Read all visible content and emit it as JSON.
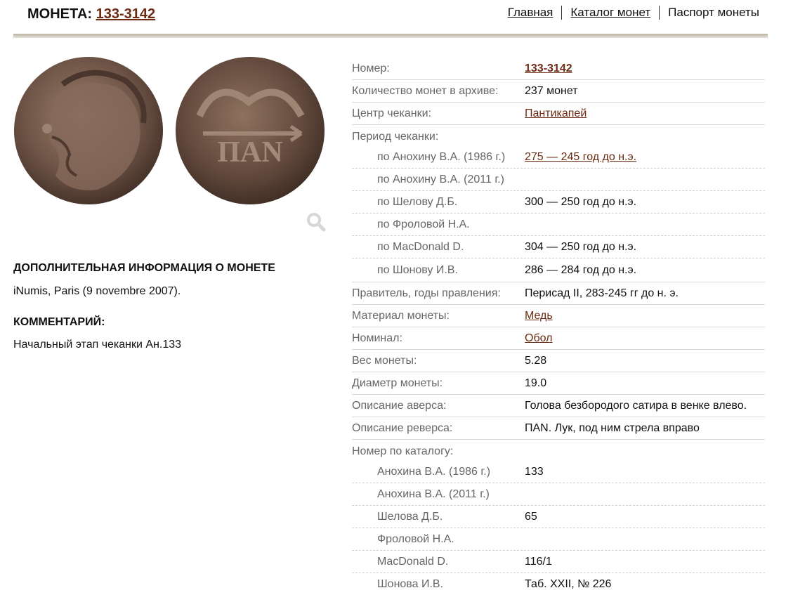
{
  "header": {
    "title_prefix": "МОНЕТА:",
    "coin_id": "133-3142",
    "nav": [
      "Главная",
      "Каталог монет",
      "Паспорт монеты"
    ]
  },
  "images": {
    "obverse_icon": "coin-obverse-image",
    "reverse_icon": "coin-reverse-image",
    "reverse_legend": "ΠΑΝ",
    "zoom_icon": "magnifier-icon"
  },
  "left": {
    "extra_title": "ДОПОЛНИТЕЛЬНАЯ ИНФОРМАЦИЯ О МОНЕТЕ",
    "extra_text": "iNumis, Paris (9 novembre 2007).",
    "comment_title": "КОММЕНТАРИЙ:",
    "comment_text": "Начальный этап чеканки Ан.133"
  },
  "info": {
    "number": {
      "label": "Номер:",
      "value": "133-3142"
    },
    "count": {
      "label": "Количество монет в архиве:",
      "value": "237 монет"
    },
    "mint": {
      "label": "Центр чеканки:",
      "value": "Пантикапей"
    },
    "period": {
      "label": "Период чеканки:",
      "rows": [
        {
          "label": "по Анохину В.А. (1986 г.)",
          "value": "275 — 245 год до н.э."
        },
        {
          "label": "по Анохину В.А. (2011 г.)",
          "value": ""
        },
        {
          "label": "по Шелову Д.Б.",
          "value": "300 — 250 год до н.э."
        },
        {
          "label": "по Фроловой Н.А.",
          "value": ""
        },
        {
          "label": "по MacDonald D.",
          "value": "304 — 250 год до н.э."
        },
        {
          "label": "по Шонову И.В.",
          "value": "286 — 284 год до н.э."
        }
      ]
    },
    "ruler": {
      "label": "Правитель, годы правления:",
      "value": "Перисад II, 283-245 гг до н. э."
    },
    "material": {
      "label": "Материал монеты:",
      "value": "Медь"
    },
    "nominal": {
      "label": "Номинал:",
      "value": "Обол"
    },
    "weight": {
      "label": "Вес монеты:",
      "value": "5.28"
    },
    "diameter": {
      "label": "Диаметр монеты:",
      "value": "19.0"
    },
    "obverse": {
      "label": "Описание аверса:",
      "value": "Голова безбородого сатира в венке влево."
    },
    "reverse": {
      "label": "Описание реверса:",
      "value": "ПАN. Лук, под ним стрела вправо"
    },
    "catalog": {
      "label": "Номер по каталогу:",
      "rows": [
        {
          "label": "Анохина В.А. (1986 г.)",
          "value": "133"
        },
        {
          "label": "Анохина В.А. (2011 г.)",
          "value": ""
        },
        {
          "label": "Шелова Д.Б.",
          "value": "65"
        },
        {
          "label": "Фроловой Н.А.",
          "value": ""
        },
        {
          "label": "MacDonald D.",
          "value": "116/1"
        },
        {
          "label": "Шонова И.В.",
          "value": "Таб. XXII, № 226"
        }
      ]
    }
  }
}
